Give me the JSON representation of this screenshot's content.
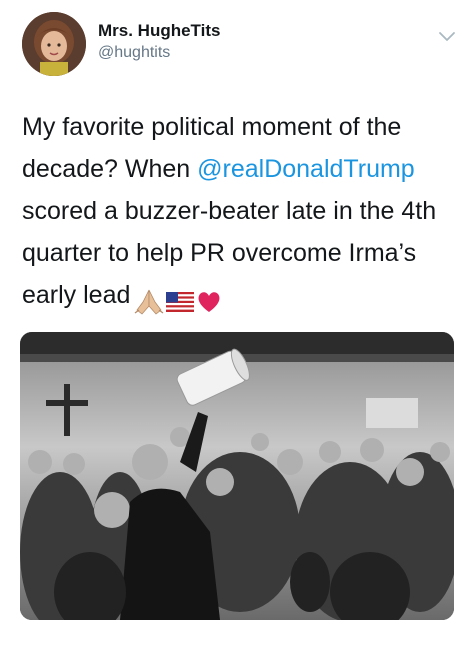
{
  "user": {
    "display_name": "Mrs. HugheTits",
    "handle": "@hughtits"
  },
  "tweet": {
    "text_before_mention": "My favorite political moment of the decade? When ",
    "mention": "@realDonaldTrump",
    "text_after_mention": " scored a buzzer-beater late in the 4th quarter to help PR overcome Irma’s early lead",
    "emojis": [
      "folded-hands-emoji",
      "us-flag-emoji",
      "red-heart-emoji"
    ]
  },
  "media": {
    "description_icon": "photo-black-and-white"
  },
  "colors": {
    "link": "#1b95e0",
    "secondary_text": "#657786",
    "primary_text": "#14171a"
  }
}
